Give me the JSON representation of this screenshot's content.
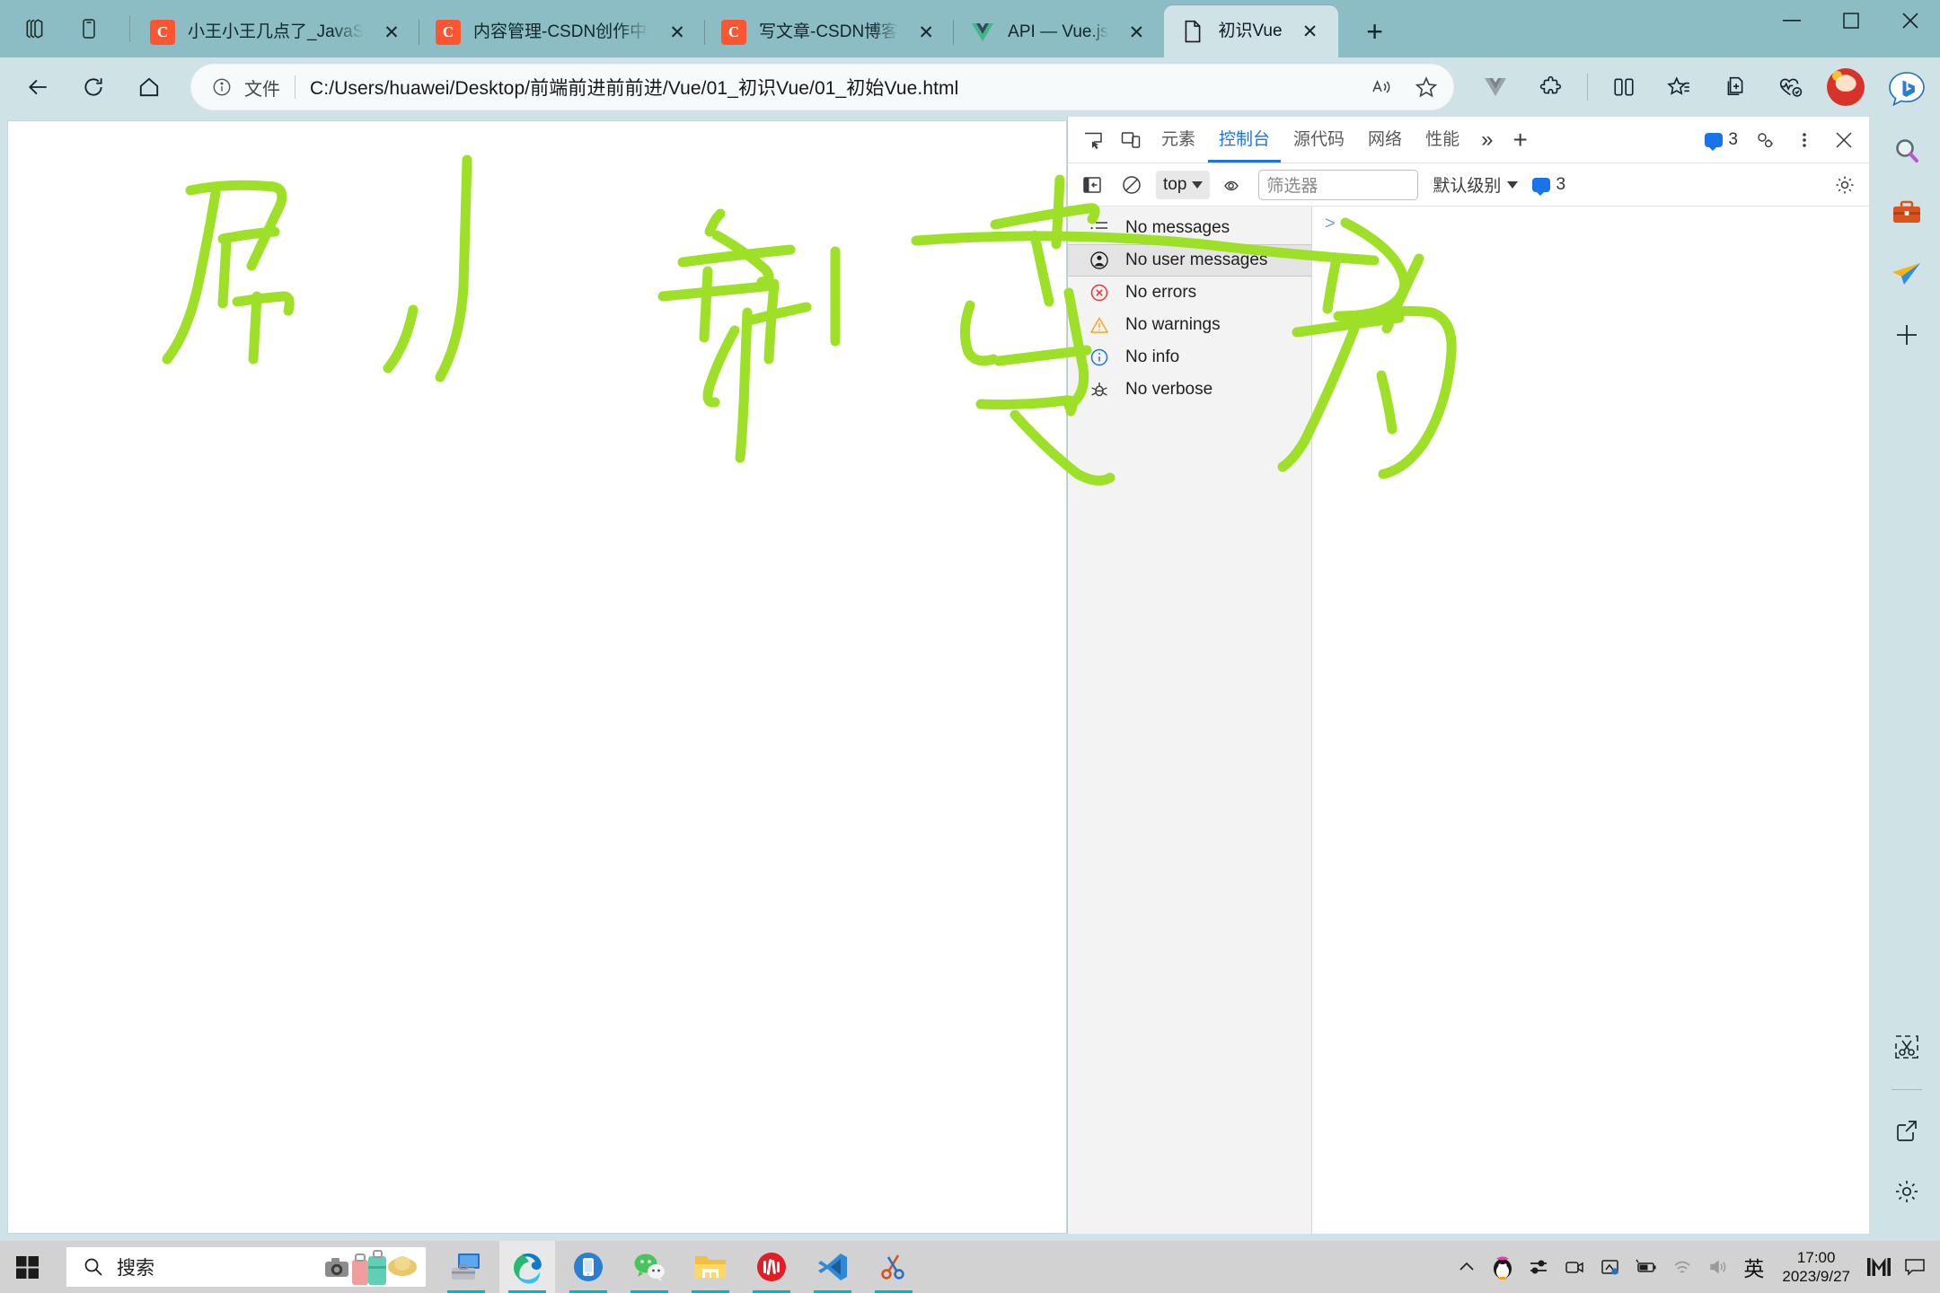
{
  "window": {
    "tab_strip_icons": [
      "workspaces-icon",
      "tab-actions-icon"
    ],
    "controls": {
      "minimize": "–",
      "maximize": "▢",
      "close": "✕",
      "new_tab": "+"
    }
  },
  "tabs": [
    {
      "title": "小王小王几点了_JavaSc",
      "favicon": "csdn-icon",
      "favicon_letter": "C",
      "active": false,
      "close": "✕"
    },
    {
      "title": "内容管理-CSDN创作中心",
      "favicon": "csdn-icon",
      "favicon_letter": "C",
      "active": false,
      "close": "✕"
    },
    {
      "title": "写文章-CSDN博客",
      "favicon": "csdn-icon",
      "favicon_letter": "C",
      "active": false,
      "close": "✕"
    },
    {
      "title": "API — Vue.js",
      "favicon": "vue-icon",
      "favicon_letter": "",
      "active": false,
      "close": "✕"
    },
    {
      "title": "初识Vue",
      "favicon": "document-icon",
      "favicon_letter": "",
      "active": true,
      "close": "✕"
    }
  ],
  "navbar": {
    "back": "back-arrow-icon",
    "reload": "reload-icon",
    "home": "home-icon",
    "url_kind": "文件",
    "url": "C:/Users/huawei/Desktop/前端前进前前进/Vue/01_初识Vue/01_初始Vue.html",
    "read_aloud": "read-aloud-icon",
    "favorite": "star-icon",
    "toolbar_icons": [
      "vue-devtools-icon",
      "extensions-icon",
      "split-screen-icon",
      "collections-icon",
      "add-to-collections-icon",
      "browser-essentials-icon"
    ],
    "profile": "avatar",
    "settings_more": "…"
  },
  "edge_sidebar": {
    "top_icons": [
      "bing-copilot-icon",
      "search-icon",
      "tools-icon",
      "paper-plane-icon",
      "add-icon"
    ],
    "bottom_icons": [
      "snip-icon",
      "open-in-new-icon",
      "settings-gear-icon"
    ]
  },
  "annotation": {
    "handwriting_text": "刷新变为",
    "color": "#9ee028",
    "arrow": "green-arrow-right"
  },
  "devtools": {
    "dock_icons": [
      "inspect-element-icon",
      "device-toolbar-icon"
    ],
    "tabs": [
      {
        "label": "元素",
        "active": false
      },
      {
        "label": "控制台",
        "active": true
      },
      {
        "label": "源代码",
        "active": false
      },
      {
        "label": "网络",
        "active": false
      },
      {
        "label": "性能",
        "active": false
      }
    ],
    "more_tabs": "»",
    "add_tab": "+",
    "issues_count": "3",
    "right_icons": [
      "devtools-settings-icon",
      "more-options-icon",
      "close-devtools-icon"
    ],
    "console_toolbar": {
      "sidebar_toggle": "console-sidebar-toggle-icon",
      "clear": "clear-console-icon",
      "context": "top",
      "live_expression": "eye-icon",
      "filter_placeholder": "筛选器",
      "filter_value": "",
      "level": "默认级别",
      "issue_badge": "3",
      "settings": "console-settings-icon"
    },
    "sidebar_items": [
      {
        "label": "No messages",
        "icon": "list-icon",
        "selected": false
      },
      {
        "label": "No user messages",
        "icon": "user-icon",
        "selected": true
      },
      {
        "label": "No errors",
        "icon": "error-icon",
        "selected": false
      },
      {
        "label": "No warnings",
        "icon": "warning-icon",
        "selected": false
      },
      {
        "label": "No info",
        "icon": "info-icon",
        "selected": false
      },
      {
        "label": "No verbose",
        "icon": "verbose-bug-icon",
        "selected": false
      }
    ],
    "prompt": ">"
  },
  "taskbar": {
    "start": "windows-start-icon",
    "search_placeholder": "搜索",
    "apps": [
      {
        "name": "computer-toolbox-icon",
        "active": false,
        "running": true
      },
      {
        "name": "microsoft-edge-icon",
        "active": true,
        "running": true
      },
      {
        "name": "phone-link-icon",
        "active": false,
        "running": true
      },
      {
        "name": "wechat-icon",
        "active": false,
        "running": true
      },
      {
        "name": "file-explorer-icon",
        "active": false,
        "running": true
      },
      {
        "name": "netease-music-icon",
        "active": false,
        "running": true
      },
      {
        "name": "vscode-icon",
        "active": false,
        "running": true
      },
      {
        "name": "snipaste-icon",
        "active": false,
        "running": true
      }
    ],
    "tray": [
      "show-hidden-icons-icon",
      "qq-icon",
      "settings-sliders-icon",
      "camera-icon",
      "screenshot-icon",
      "battery-icon",
      "wifi-icon",
      "volume-icon"
    ],
    "ime": "英",
    "time": "17:00",
    "date": "2023/9/27",
    "right_icons": [
      "msedge-m-icon",
      "notification-icon"
    ]
  },
  "colors": {
    "titlebar": "#8cbcc4",
    "toolbar": "#cfe3e7",
    "accent": "#1a73e8",
    "ink": "#9ee028",
    "taskbar": "#d2d2d2"
  }
}
